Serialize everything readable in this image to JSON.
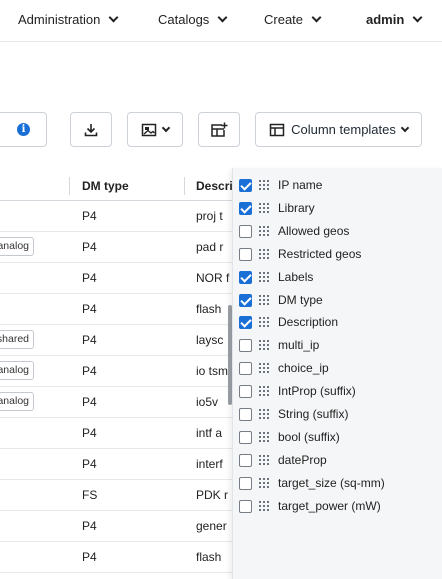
{
  "nav": {
    "administration": "Administration",
    "catalogs": "Catalogs",
    "create": "Create",
    "user": "admin"
  },
  "toolbar": {
    "column_templates_label": "Column templates",
    "icons": [
      "info-icon",
      "download-icon",
      "image-icon",
      "add-column-icon",
      "column-layout-icon"
    ]
  },
  "table": {
    "headers": {
      "dm_type": "DM type",
      "description": "Descri"
    },
    "rows": [
      {
        "tag": "",
        "dm_type": "P4",
        "desc": "proj t"
      },
      {
        "tag": "analog",
        "dm_type": "P4",
        "desc": "pad r"
      },
      {
        "tag": "",
        "dm_type": "P4",
        "desc": "NOR f"
      },
      {
        "tag": "",
        "dm_type": "P4",
        "desc": "flash"
      },
      {
        "tag": "shared",
        "dm_type": "P4",
        "desc": "laysc"
      },
      {
        "tag": "analog",
        "dm_type": "P4",
        "desc": "io tsm"
      },
      {
        "tag": "analog",
        "dm_type": "P4",
        "desc": "io5v"
      },
      {
        "tag": "",
        "dm_type": "P4",
        "desc": "intf a"
      },
      {
        "tag": "",
        "dm_type": "P4",
        "desc": "interf"
      },
      {
        "tag": "",
        "dm_type": "FS",
        "desc": "PDK r"
      },
      {
        "tag": "",
        "dm_type": "P4",
        "desc": "gener"
      },
      {
        "tag": "",
        "dm_type": "P4",
        "desc": "flash"
      }
    ]
  },
  "columns_menu": {
    "options": [
      {
        "label": "IP name",
        "checked": true
      },
      {
        "label": "Library",
        "checked": true
      },
      {
        "label": "Allowed geos",
        "checked": false
      },
      {
        "label": "Restricted geos",
        "checked": false
      },
      {
        "label": "Labels",
        "checked": true
      },
      {
        "label": "DM type",
        "checked": true
      },
      {
        "label": "Description",
        "checked": true
      },
      {
        "label": "multi_ip",
        "checked": false
      },
      {
        "label": "choice_ip",
        "checked": false
      },
      {
        "label": "IntProp (suffix)",
        "checked": false
      },
      {
        "label": "String (suffix)",
        "checked": false
      },
      {
        "label": "bool (suffix)",
        "checked": false
      },
      {
        "label": "dateProp",
        "checked": false
      },
      {
        "label": "target_size (sq-mm)",
        "checked": false
      },
      {
        "label": "target_power (mW)",
        "checked": false
      }
    ]
  },
  "colors": {
    "accent": "#1a6fd6",
    "menu_bg": "#f5f6f7"
  }
}
